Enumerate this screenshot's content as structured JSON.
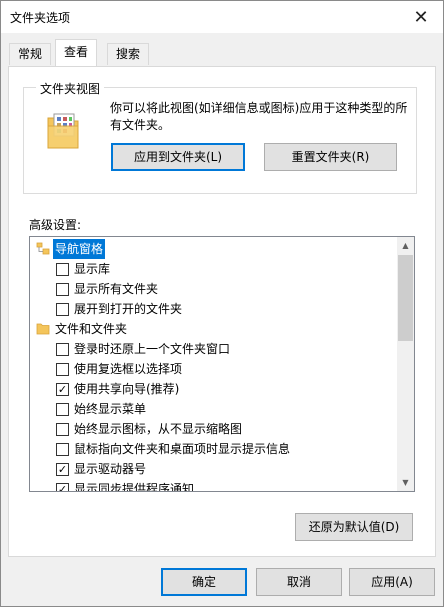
{
  "window": {
    "title": "文件夹选项",
    "close_glyph": "✕"
  },
  "tabs": [
    {
      "label": "常规",
      "active": false
    },
    {
      "label": "查看",
      "active": true
    },
    {
      "label": "搜索",
      "active": false
    }
  ],
  "folder_view": {
    "title": "文件夹视图",
    "description": "你可以将此视图(如详细信息或图标)应用于这种类型的所有文件夹。",
    "apply_button": "应用到文件夹(L)",
    "reset_button": "重置文件夹(R)"
  },
  "advanced": {
    "label": "高级设置:",
    "items": [
      {
        "type": "category",
        "label": "导航窗格",
        "selected": true,
        "icon": "folder-tree-icon"
      },
      {
        "type": "checkbox",
        "label": "显示库",
        "checked": false
      },
      {
        "type": "checkbox",
        "label": "显示所有文件夹",
        "checked": false
      },
      {
        "type": "checkbox",
        "label": "展开到打开的文件夹",
        "checked": false
      },
      {
        "type": "category",
        "label": "文件和文件夹",
        "selected": false,
        "icon": "folder-icon"
      },
      {
        "type": "checkbox",
        "label": "登录时还原上一个文件夹窗口",
        "checked": false
      },
      {
        "type": "checkbox",
        "label": "使用复选框以选择项",
        "checked": false
      },
      {
        "type": "checkbox",
        "label": "使用共享向导(推荐)",
        "checked": true
      },
      {
        "type": "checkbox",
        "label": "始终显示菜单",
        "checked": false
      },
      {
        "type": "checkbox",
        "label": "始终显示图标，从不显示缩略图",
        "checked": false
      },
      {
        "type": "checkbox",
        "label": "鼠标指向文件夹和桌面项时显示提示信息",
        "checked": false
      },
      {
        "type": "checkbox",
        "label": "显示驱动器号",
        "checked": true
      },
      {
        "type": "checkbox",
        "label": "显示同步提供程序通知",
        "checked": true
      }
    ],
    "restore_button": "还原为默认值(D)"
  },
  "footer": {
    "ok": "确定",
    "cancel": "取消",
    "apply": "应用(A)"
  },
  "colors": {
    "selection": "#0078d7",
    "folder": "#f4c55b"
  }
}
